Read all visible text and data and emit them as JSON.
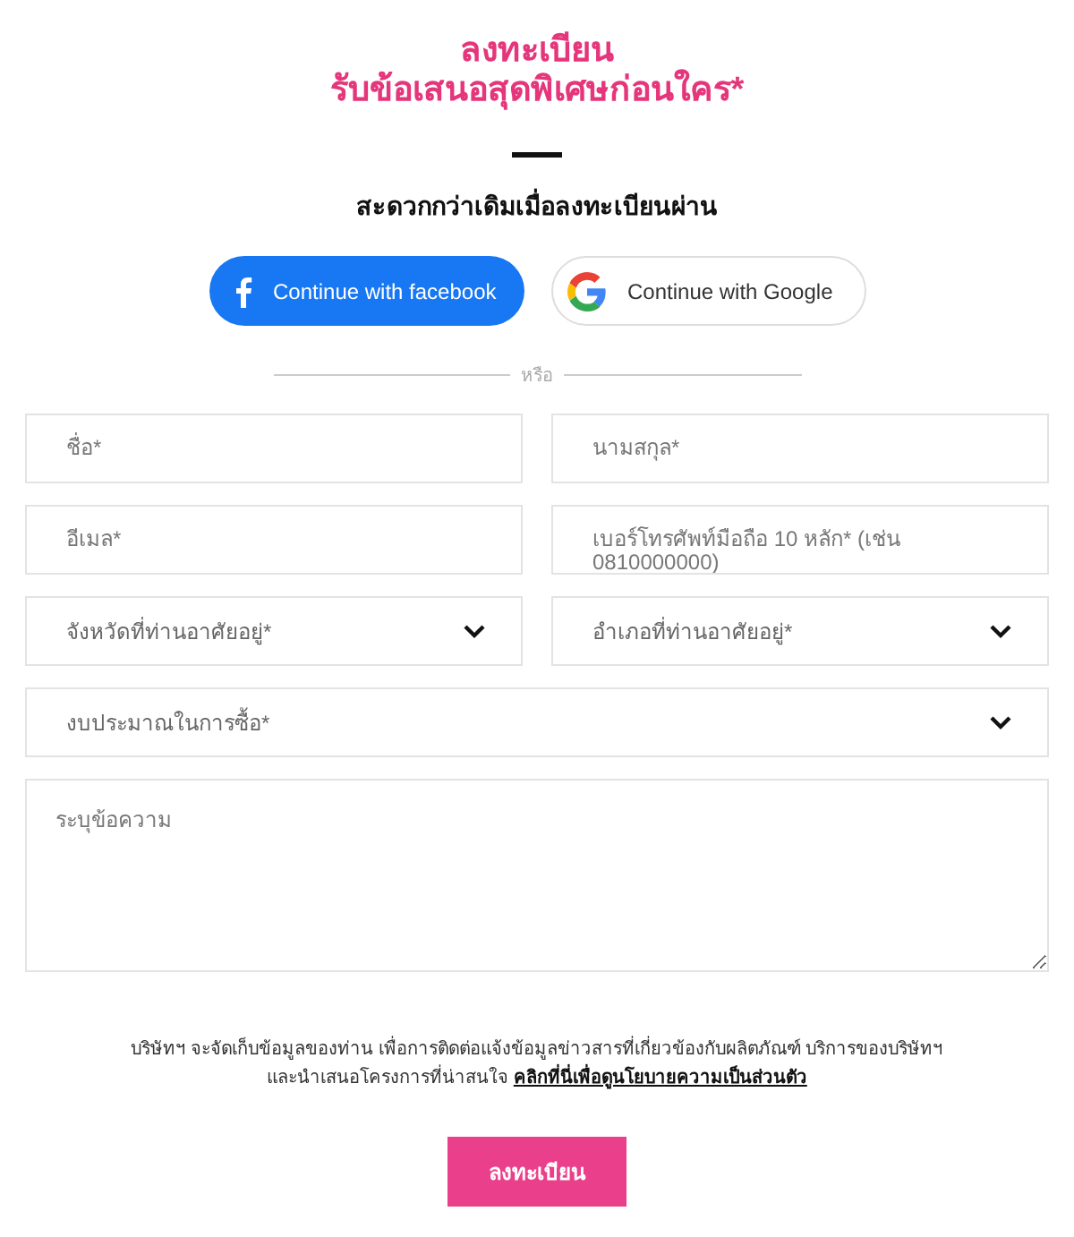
{
  "heading": {
    "title": "ลงทะเบียน",
    "subtitle": "รับข้อเสนอสุดพิเศษก่อนใคร*"
  },
  "social_prompt": "สะดวกกว่าเดิมเมื่อลงทะเบียนผ่าน",
  "social_buttons": [
    {
      "kind": "facebook",
      "label": "Continue with facebook"
    },
    {
      "kind": "google",
      "label": "Continue with Google"
    }
  ],
  "divider_label": "หรือ",
  "field_rows": [
    [
      {
        "kind": "text",
        "placeholder": "ชื่อ*"
      },
      {
        "kind": "text",
        "placeholder": "นามสกุล*"
      }
    ],
    [
      {
        "kind": "text",
        "placeholder": "อีเมล*"
      },
      {
        "kind": "text",
        "placeholder": "เบอร์โทรศัพท์มือถือ 10 หลัก* (เช่น 0810000000)"
      }
    ],
    [
      {
        "kind": "select",
        "placeholder": "จังหวัดที่ท่านอาศัยอยู่*"
      },
      {
        "kind": "select",
        "placeholder": "อำเภอที่ท่านอาศัยอยู่*"
      }
    ],
    [
      {
        "kind": "select",
        "placeholder": "งบประมาณในการซื้อ*"
      }
    ],
    [
      {
        "kind": "textarea",
        "placeholder": "ระบุข้อความ"
      }
    ]
  ],
  "notice": {
    "text": "บริษัทฯ จะจัดเก็บข้อมูลของท่าน เพื่อการติดต่อแจ้งข้อมูลข่าวสารที่เกี่ยวข้องกับผลิตภัณฑ์ บริการของบริษัทฯ และนำเสนอโครงการที่น่าสนใจ",
    "link": "คลิกที่นี่เพื่อดูนโยบายความเป็นส่วนตัว"
  },
  "submit": "ลงทะเบียน"
}
